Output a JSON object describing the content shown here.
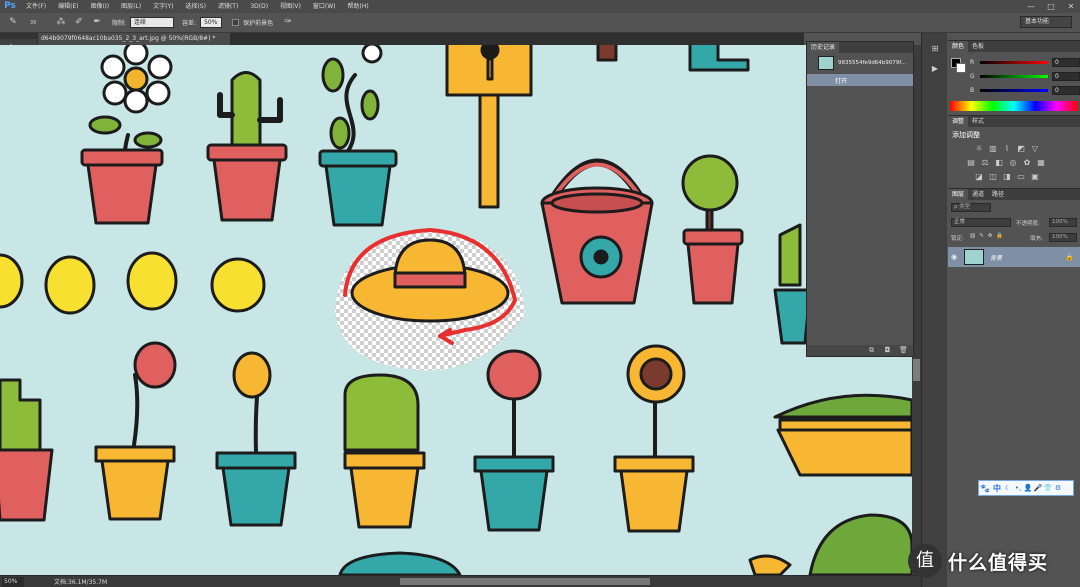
{
  "app": {
    "logo": "Ps",
    "menu": [
      "文件(F)",
      "编辑(E)",
      "图像(I)",
      "图层(L)",
      "文字(Y)",
      "选择(S)",
      "滤镜(T)",
      "3D(D)",
      "视图(V)",
      "窗口(W)",
      "帮助(H)"
    ],
    "window_controls": [
      "—",
      "□",
      "✕"
    ]
  },
  "options_bar": {
    "brush_size": "39",
    "limits_label": "限制:",
    "limits_value": "连续",
    "tolerance_label": "容差:",
    "tolerance_value": "50%",
    "protect_fg_label": "保护前景色",
    "workspace": "基本功能"
  },
  "document": {
    "tab_title": "d64b9079f0648ac10ba035_2_3_art.jpg @ 50%(RGB/8#) *",
    "zoom": "50%",
    "doc_info": "文档:36.1M/35.7M"
  },
  "history_panel": {
    "tab": "历史记录",
    "snapshot_name": "9835554fe9d64b9079f...",
    "entries": [
      "打开"
    ]
  },
  "color_panel": {
    "tabs": [
      "颜色",
      "色板"
    ],
    "channels": [
      {
        "label": "R",
        "value": "0"
      },
      {
        "label": "G",
        "value": "0"
      },
      {
        "label": "B",
        "value": "0"
      }
    ]
  },
  "adjust_panel": {
    "tabs": [
      "调整",
      "样式"
    ],
    "title": "添加调整"
  },
  "layers_panel": {
    "tabs": [
      "图层",
      "通道",
      "路径"
    ],
    "filter_label": "ρ 类型",
    "blend_mode": "正常",
    "opacity_label": "不透明度:",
    "opacity_value": "100%",
    "lock_label": "锁定:",
    "fill_label": "填充:",
    "fill_value": "100%",
    "layer_name": "背景"
  },
  "ime_bar": {
    "lang": "中"
  },
  "watermark": {
    "badge": "值",
    "text": "什么值得买"
  }
}
